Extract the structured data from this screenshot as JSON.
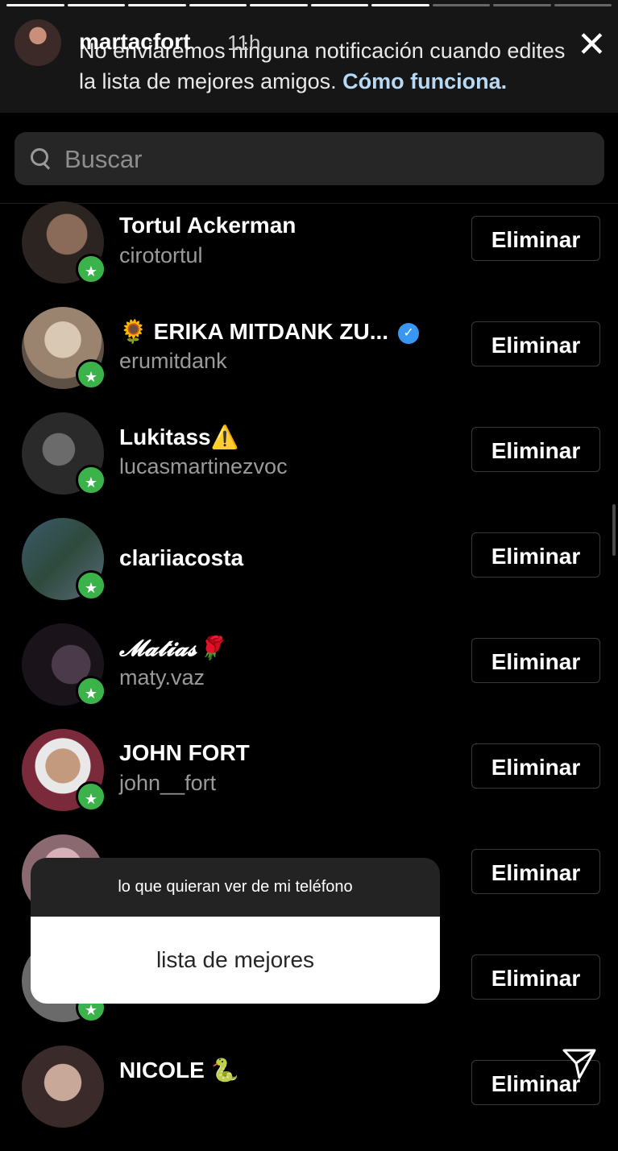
{
  "story": {
    "username": "martacfort",
    "time": "11h",
    "progress_segments": [
      true,
      true,
      true,
      true,
      true,
      true,
      true,
      false,
      false,
      false
    ]
  },
  "notice": {
    "text": "No enviaremos ninguna notificación cuando edites la lista de mejores amigos. ",
    "link": "Cómo funciona."
  },
  "search": {
    "placeholder": "Buscar"
  },
  "friends": [
    {
      "name": "Tortul Ackerman",
      "handle": "cirotortul",
      "button": "Eliminar"
    },
    {
      "name": "🌻 ERIKA MITDANK ZU...",
      "handle": "erumitdank",
      "verified": true,
      "button": "Eliminar"
    },
    {
      "name": "Lukitass⚠️",
      "handle": "lucasmartinezvoc",
      "button": "Eliminar"
    },
    {
      "name": "clariiacosta",
      "handle": "",
      "button": "Eliminar"
    },
    {
      "name": "𝓜𝓪𝓽𝓲𝓪𝓼🌹",
      "handle": "maty.vaz",
      "button": "Eliminar"
    },
    {
      "name": "JOHN FORT",
      "handle": "john__fort",
      "button": "Eliminar"
    },
    {
      "name": "",
      "handle": "",
      "button": "Eliminar"
    },
    {
      "name": "",
      "handle": "",
      "button": "Eliminar"
    },
    {
      "name": "NICOLE 🐍",
      "handle": "",
      "button": "Eliminar"
    }
  ],
  "popup": {
    "question": "lo que quieran ver de mi teléfono",
    "answer": "lista de mejores"
  },
  "colors": {
    "badge_green": "#3bb34a",
    "link": "#b8d9f4",
    "verified_blue": "#3897f0"
  }
}
